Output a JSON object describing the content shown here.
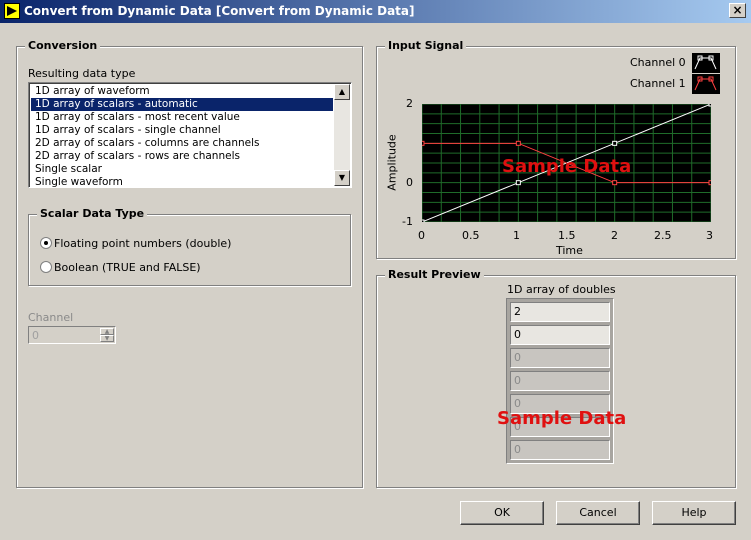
{
  "window": {
    "title": "Convert from Dynamic Data [Convert from Dynamic Data]",
    "close_glyph": "×"
  },
  "conversion": {
    "title": "Conversion",
    "list_label": "Resulting data type",
    "items": [
      "1D array of waveform",
      "1D array of scalars - automatic",
      "1D array of scalars - most recent value",
      "1D array of scalars - single channel",
      "2D array of scalars - columns are channels",
      "2D array of scalars - rows are channels",
      "Single scalar",
      "Single waveform"
    ],
    "selected_index": 1,
    "scalar_type": {
      "title": "Scalar Data Type",
      "options": [
        "Floating point numbers (double)",
        "Boolean (TRUE and FALSE)"
      ],
      "selected_index": 0
    },
    "channel": {
      "label": "Channel",
      "value": "0"
    }
  },
  "input_signal": {
    "title": "Input Signal",
    "legend": [
      "Channel 0",
      "Channel 1"
    ],
    "watermark": "Sample Data"
  },
  "result_preview": {
    "title": "Result Preview",
    "array_label": "1D array of doubles",
    "values": [
      "2",
      "0",
      "0",
      "0",
      "0",
      "0",
      "0"
    ],
    "watermark": "Sample Data"
  },
  "buttons": {
    "ok": "OK",
    "cancel": "Cancel",
    "help": "Help"
  },
  "colors": {
    "title_bar": "#0a246a",
    "selection": "#0a246a",
    "channel0": "#ffffff",
    "channel1": "#ff4040",
    "plot_bg": "#000000",
    "grid": "#1f6b2a",
    "watermark": "#e01010"
  },
  "chart_data": {
    "type": "line",
    "xlabel": "Time",
    "ylabel": "Amplitude",
    "xlim": [
      0,
      3
    ],
    "ylim": [
      -1,
      2
    ],
    "xticks": [
      "0",
      "0.5",
      "1",
      "1.5",
      "2",
      "2.5",
      "3"
    ],
    "yticks": [
      "2",
      "0",
      "-1"
    ],
    "grid": true,
    "series": [
      {
        "name": "Channel 0",
        "x": [
          0,
          1,
          2,
          3
        ],
        "y": [
          -1,
          0,
          1,
          2
        ]
      },
      {
        "name": "Channel 1",
        "x": [
          0,
          1,
          2,
          3
        ],
        "y": [
          1,
          1,
          0,
          0
        ]
      }
    ]
  }
}
